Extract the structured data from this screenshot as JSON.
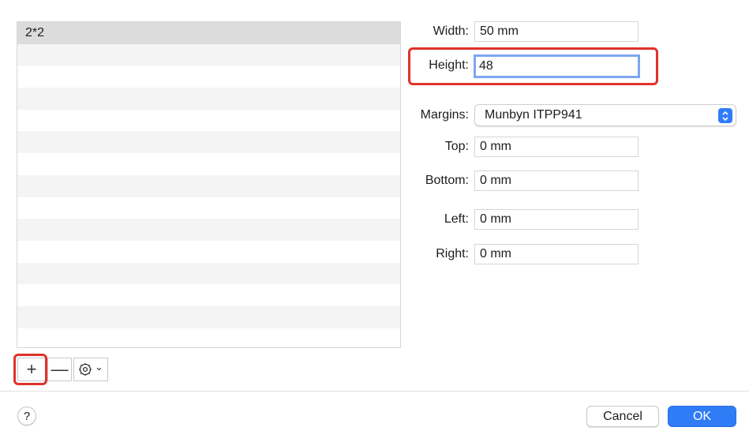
{
  "paper_sizes": {
    "items": [
      {
        "label": "2*2",
        "selected": true
      },
      {
        "label": ""
      },
      {
        "label": ""
      },
      {
        "label": ""
      },
      {
        "label": ""
      },
      {
        "label": ""
      },
      {
        "label": ""
      },
      {
        "label": ""
      },
      {
        "label": ""
      },
      {
        "label": ""
      },
      {
        "label": ""
      },
      {
        "label": ""
      },
      {
        "label": ""
      },
      {
        "label": ""
      },
      {
        "label": ""
      }
    ]
  },
  "toolbar": {
    "add_symbol": "+",
    "remove_symbol": "—",
    "gear_icon": "gear-icon",
    "gear_menu_symbol": "⌄"
  },
  "form": {
    "width_label": "Width:",
    "width_value": "50 mm",
    "height_label": "Height:",
    "height_value": "48",
    "margins_label": "Margins:",
    "margins_value": "Munbyn ITPP941",
    "top_label": "Top:",
    "top_value": "0 mm",
    "bottom_label": "Bottom:",
    "bottom_value": "0 mm",
    "left_label": "Left:",
    "left_value": "0 mm",
    "right_label": "Right:",
    "right_value": "0 mm"
  },
  "footer": {
    "help_label": "?",
    "cancel_label": "Cancel",
    "ok_label": "OK"
  },
  "colors": {
    "accent": "#2f7cf6",
    "highlight": "#e0322a",
    "focus_ring": "#7da6f1"
  }
}
